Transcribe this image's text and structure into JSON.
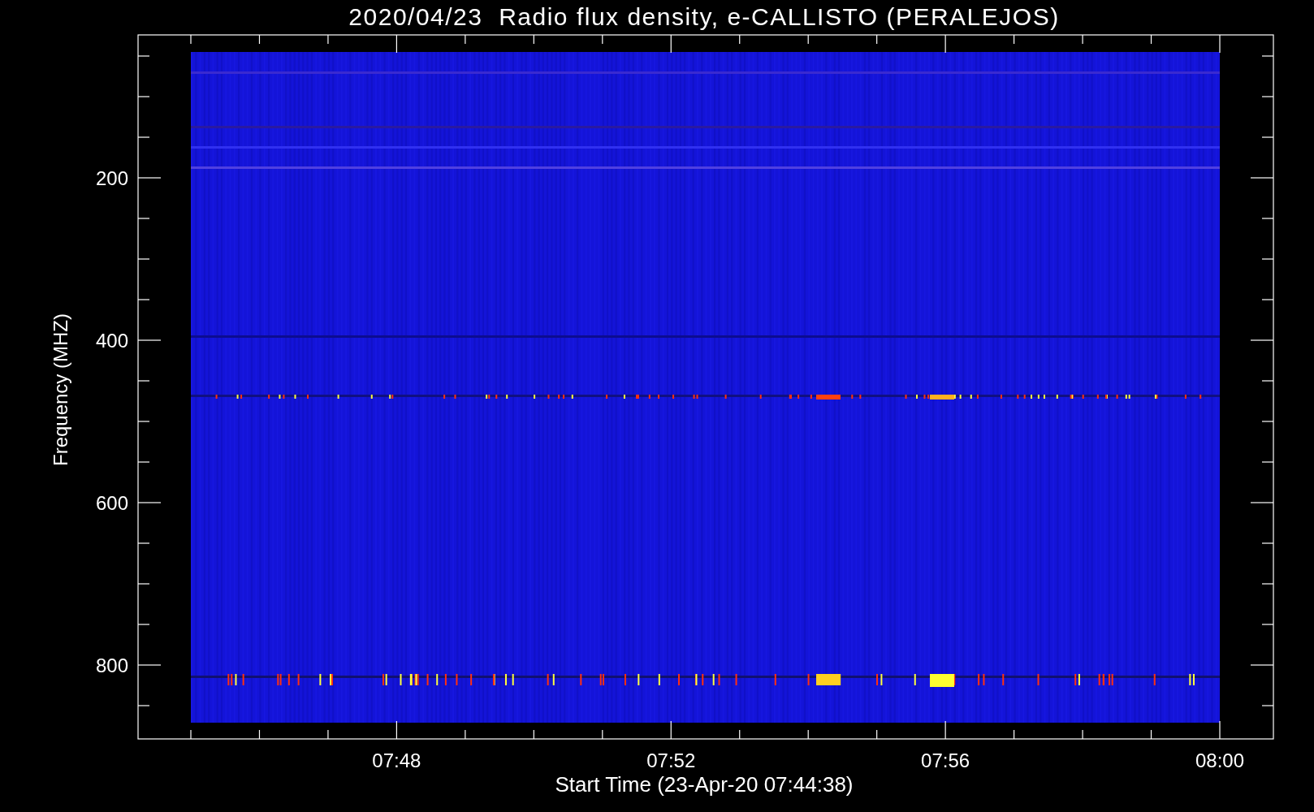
{
  "title": "2020/04/23  Radio flux density, e-CALLISTO (PERALEJOS)",
  "x_axis": {
    "label": "Start Time (23-Apr-20 07:44:38)",
    "ticks": [
      "07:48",
      "07:52",
      "07:56",
      "08:00"
    ]
  },
  "y_axis": {
    "label": "Frequency (MHZ)",
    "ticks": [
      "200",
      "400",
      "600",
      "800"
    ]
  }
}
